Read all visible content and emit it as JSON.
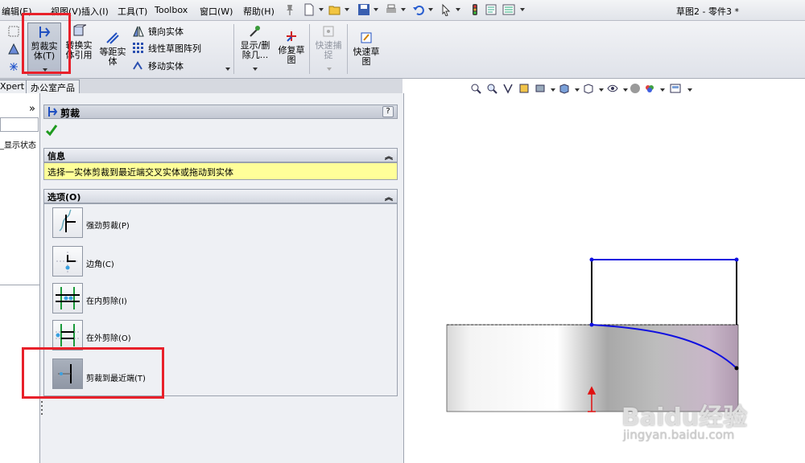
{
  "menubar": {
    "items": [
      "编辑(E)",
      "视图(V)",
      "插入(I)",
      "工具(T)",
      "Toolbox",
      "窗口(W)",
      "帮助(H)"
    ],
    "doc_title": "草图2 - 零件3 *"
  },
  "ribbon": {
    "trim_label": "剪裁实\n体(T)",
    "convert_label": "转换实\n体引用",
    "offset_label": "等距实\n体",
    "mirror_label": "镜向实体",
    "linear_pattern_label": "线性草图阵列",
    "move_label": "移动实体",
    "display_delete_label": "显示/删\n除几...",
    "repair_label": "修复草\n图",
    "quick_snap_label": "快速捕\n捉",
    "rapid_sketch_label": "快速草\n图"
  },
  "tabs": [
    "Xpert",
    "办公室产品"
  ],
  "left_panel": {
    "chevron": "»",
    "display_state": "_显示状态"
  },
  "property_manager": {
    "title": "剪裁",
    "help": "?",
    "info_header": "信息",
    "info_text": "选择一实体剪裁到最近端交叉实体或拖动到实体",
    "options_header": "选项(O)",
    "options": [
      "强劲剪裁(P)",
      "边角(C)",
      "在内剪除(I)",
      "在外剪除(O)",
      "剪裁到最近端(T)"
    ],
    "selected_option_index": 4
  },
  "watermark": {
    "brand": "Baidu经验",
    "url": "jingyan.baidu.com"
  },
  "colors": {
    "highlight": "#e8202a",
    "sketch_line": "#1010e0",
    "info_bg": "#ffff99"
  }
}
